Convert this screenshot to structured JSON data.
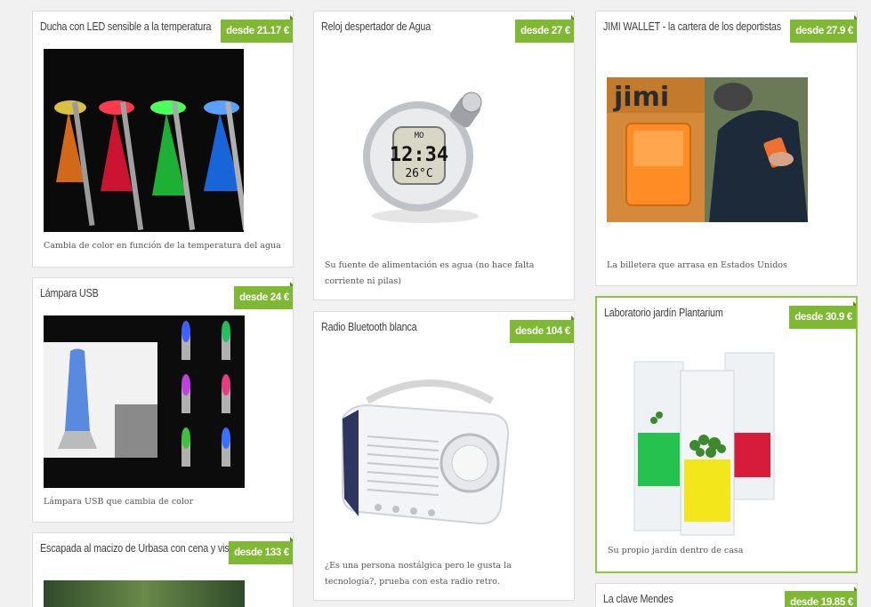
{
  "products": [
    {
      "title": "Ducha con LED sensible a la temperatura",
      "price": "desde 21.17 €",
      "description": "Cambia de color en función de la temperatura del agua"
    },
    {
      "title": "Lámpara USB",
      "price": "desde 24 €",
      "description": "Lámpara USB que cambia de color"
    },
    {
      "title": "Escapada al macizo de Urbasa con cena y visita a una quesería",
      "price": "desde 133 €",
      "description": ""
    },
    {
      "title": "Reloj despertador de Agua",
      "price": "desde 27 €",
      "description": "Su fuente de alimentación es agua (no hace falta corriente ni pilas)",
      "clock_top": "MO",
      "clock_time": "12:34",
      "clock_temp": "26°C"
    },
    {
      "title": "Radio Bluetooth blanca",
      "price": "desde 104 €",
      "description": "¿Es una persona nostálgica pero le gusta la tecnología?, prueba con esta radio retro."
    },
    {
      "title": "JIMI WALLET - la cartera de los deportistas",
      "price": "desde 27.9 €",
      "description": "La billetera que arrasa en Estados Unidos",
      "brand": "jimi"
    },
    {
      "title": "Laboratorio jardín Plantarium",
      "price": "desde 30.9 €",
      "description": "Su propio jardín dentro de casa"
    },
    {
      "title": "La clave Mendes",
      "price": "desde 19.85 €",
      "description": ""
    }
  ],
  "colors": {
    "accent": "#7fb832",
    "highlight_border": "#8dc63f",
    "background": "#f1f1f1"
  }
}
